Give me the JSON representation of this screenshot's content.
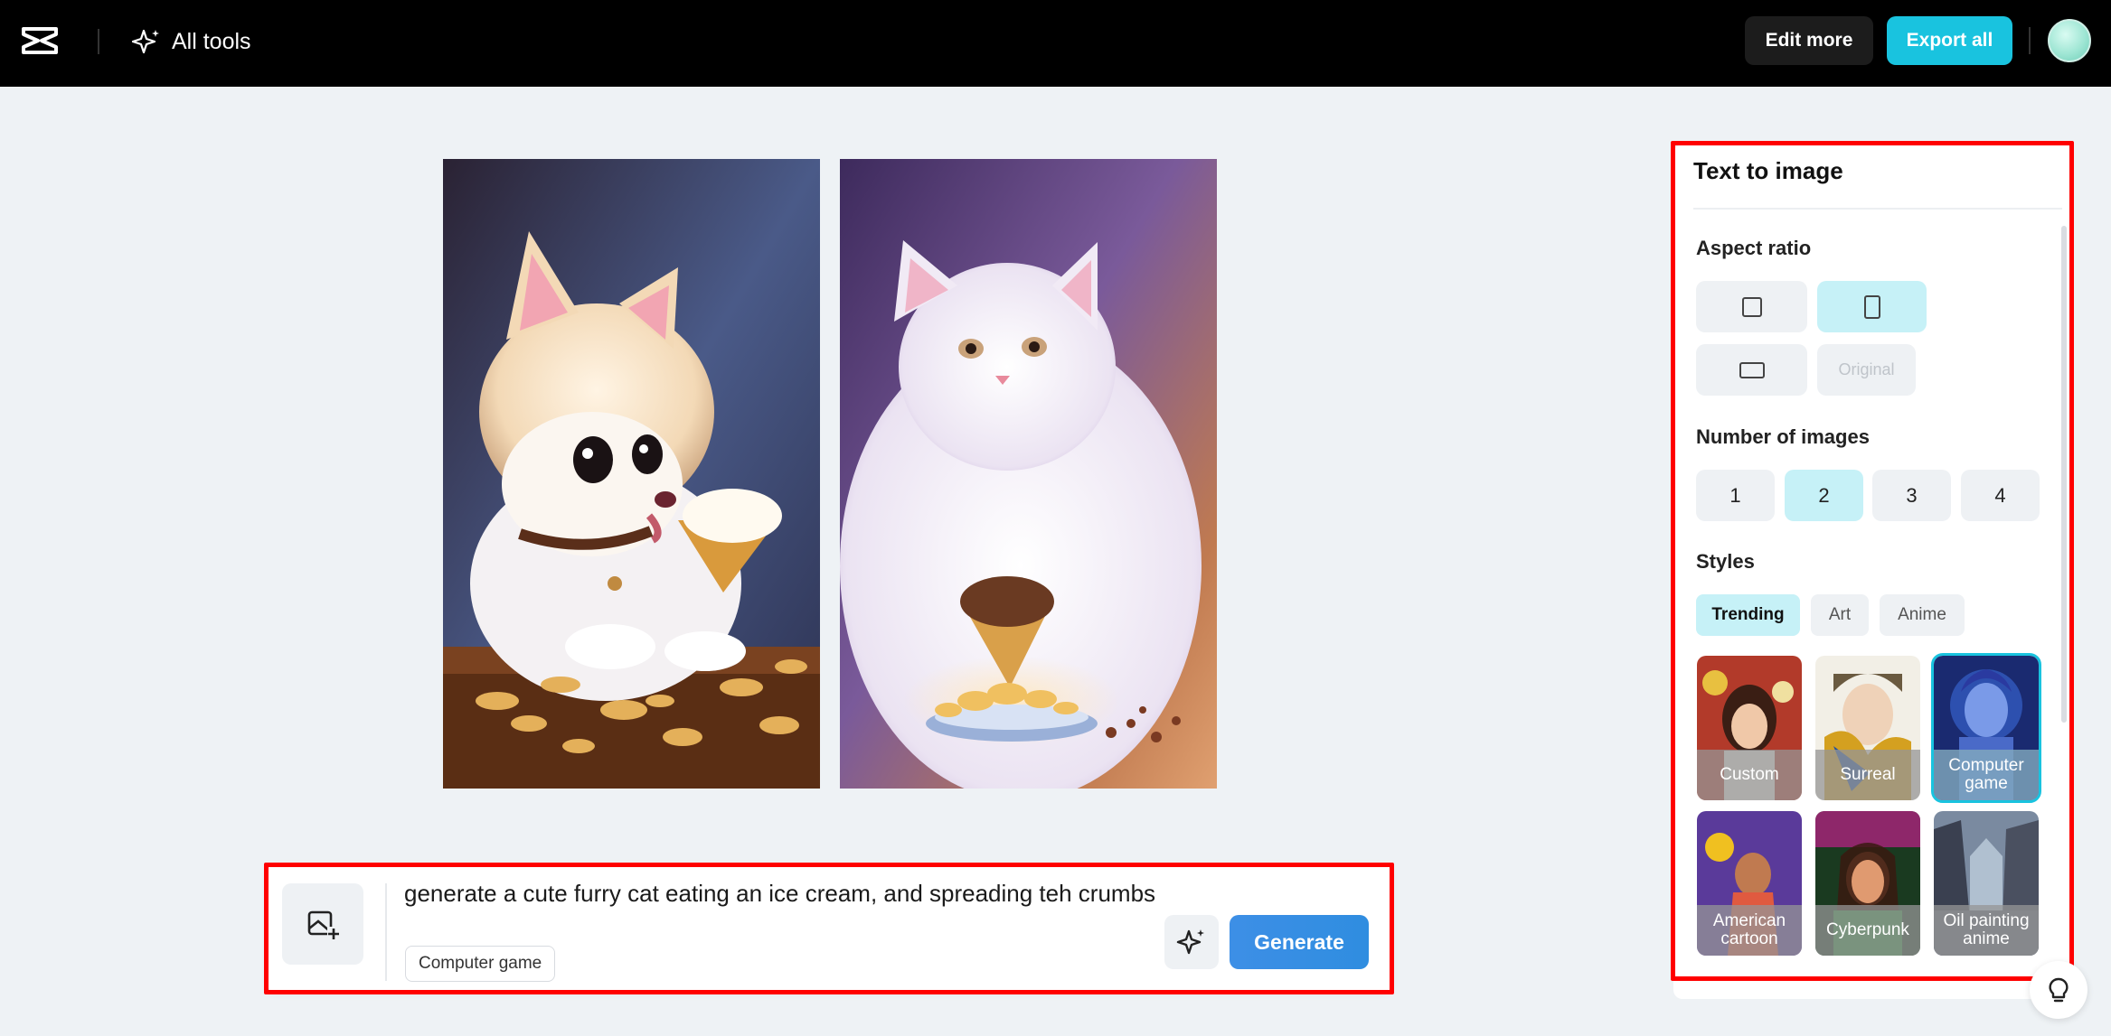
{
  "header": {
    "all_tools_label": "All tools",
    "edit_more_label": "Edit more",
    "export_all_label": "Export all"
  },
  "prompt": {
    "text": "generate a cute furry cat eating an ice cream, and spreading teh crumbs",
    "style_chip": "Computer game",
    "generate_label": "Generate"
  },
  "panel": {
    "title": "Text to image",
    "aspect_ratio": {
      "label": "Aspect ratio",
      "options": [
        {
          "name": "square",
          "selected": false
        },
        {
          "name": "portrait",
          "selected": true
        },
        {
          "name": "landscape",
          "selected": false
        },
        {
          "name": "original",
          "label": "Original",
          "selected": false,
          "disabled": true
        }
      ]
    },
    "number_of_images": {
      "label": "Number of images",
      "options": [
        "1",
        "2",
        "3",
        "4"
      ],
      "selected": "2"
    },
    "styles": {
      "label": "Styles",
      "tabs": [
        "Trending",
        "Art",
        "Anime"
      ],
      "selected_tab": "Trending",
      "cards": [
        {
          "label": "Custom",
          "selected": false
        },
        {
          "label": "Surreal",
          "selected": false
        },
        {
          "label": "Computer game",
          "selected": true
        },
        {
          "label": "American cartoon",
          "selected": false
        },
        {
          "label": "Cyberpunk",
          "selected": false
        },
        {
          "label": "Oil painting anime",
          "selected": false
        }
      ]
    }
  },
  "colors": {
    "accent": "#19c3df",
    "generate": "#3d8fe6",
    "selected_bg": "#c6f1f7",
    "highlight_outline": "#ff0000"
  }
}
